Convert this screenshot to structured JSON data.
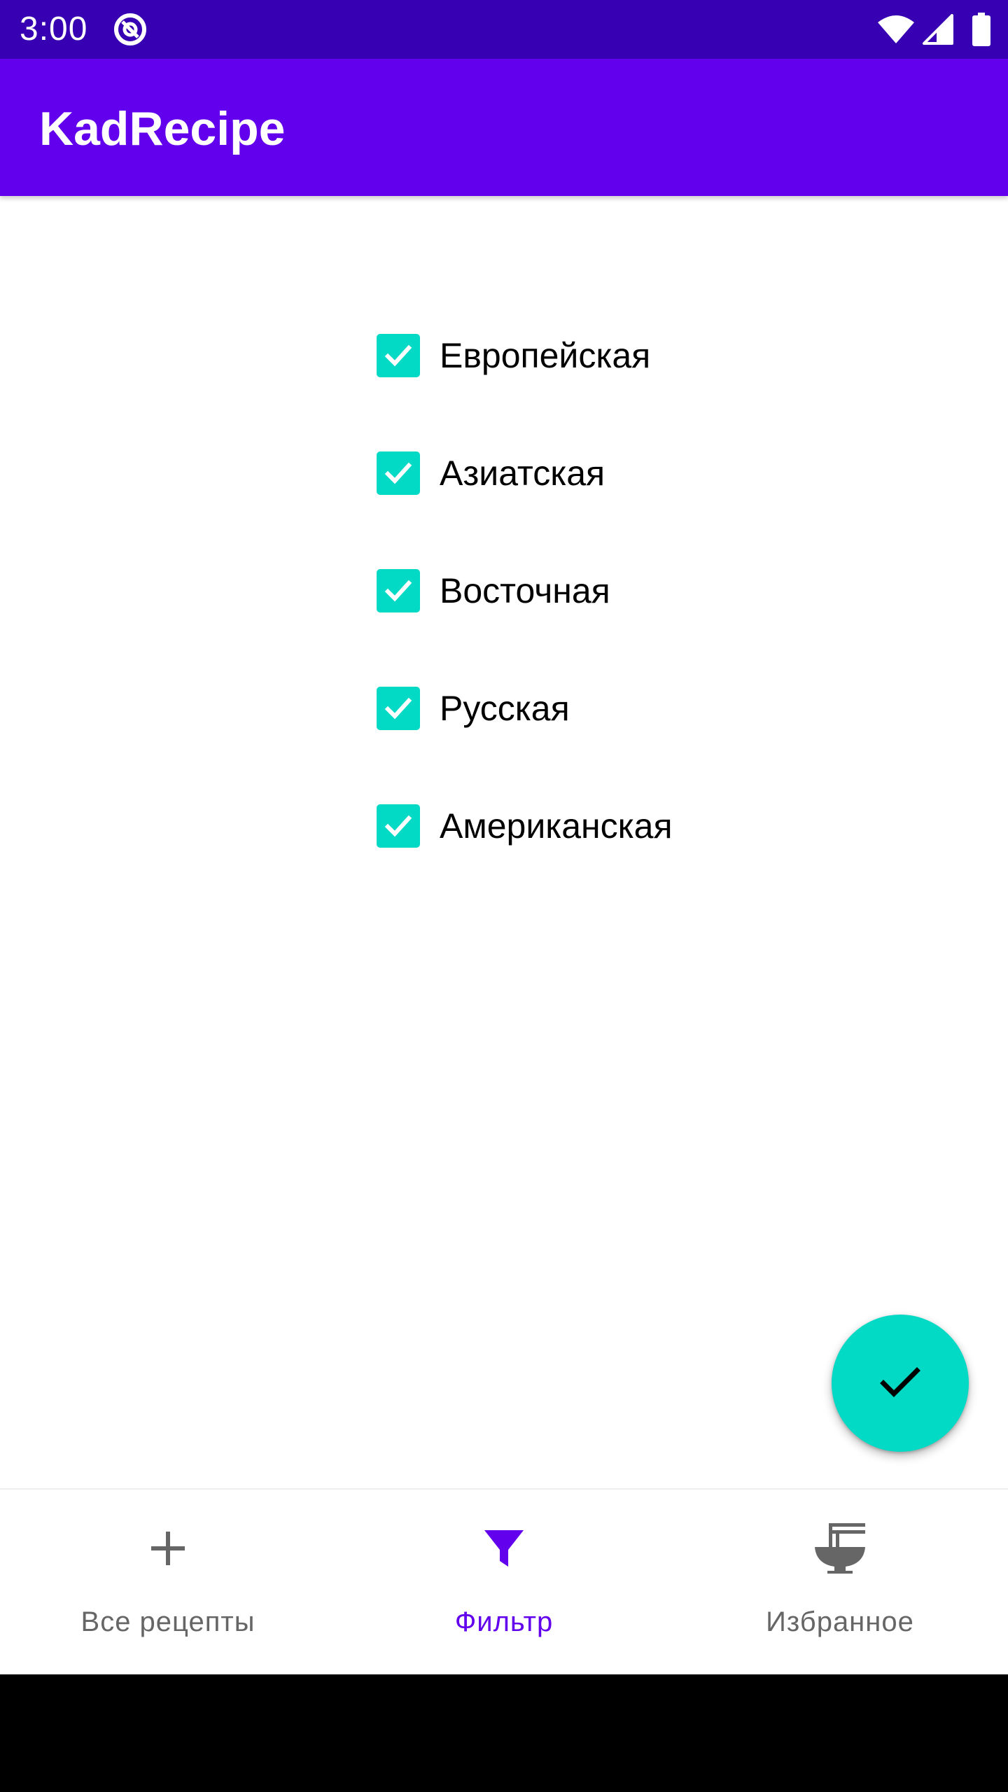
{
  "status_bar": {
    "time": "3:00",
    "app_icon": "at-sign-icon",
    "wifi_icon": "wifi-icon",
    "signal_icon": "cell-signal-icon",
    "battery_icon": "battery-icon"
  },
  "app_bar": {
    "title": "KadRecipe"
  },
  "filters": [
    {
      "label": "Европейская",
      "checked": true
    },
    {
      "label": "Азиатская",
      "checked": true
    },
    {
      "label": "Восточная",
      "checked": true
    },
    {
      "label": "Русская",
      "checked": true
    },
    {
      "label": "Американская",
      "checked": true
    }
  ],
  "fab": {
    "icon": "check-icon"
  },
  "bottom_nav": {
    "items": [
      {
        "label": "Все рецепты",
        "icon": "plus-icon",
        "active": false
      },
      {
        "label": "Фильтр",
        "icon": "funnel-icon",
        "active": true
      },
      {
        "label": "Избранное",
        "icon": "noodle-bowl-icon",
        "active": false
      }
    ]
  },
  "colors": {
    "status_bar": "#3700b3",
    "primary": "#6200ee",
    "accent": "#03dac5",
    "nav_inactive": "#666666"
  }
}
